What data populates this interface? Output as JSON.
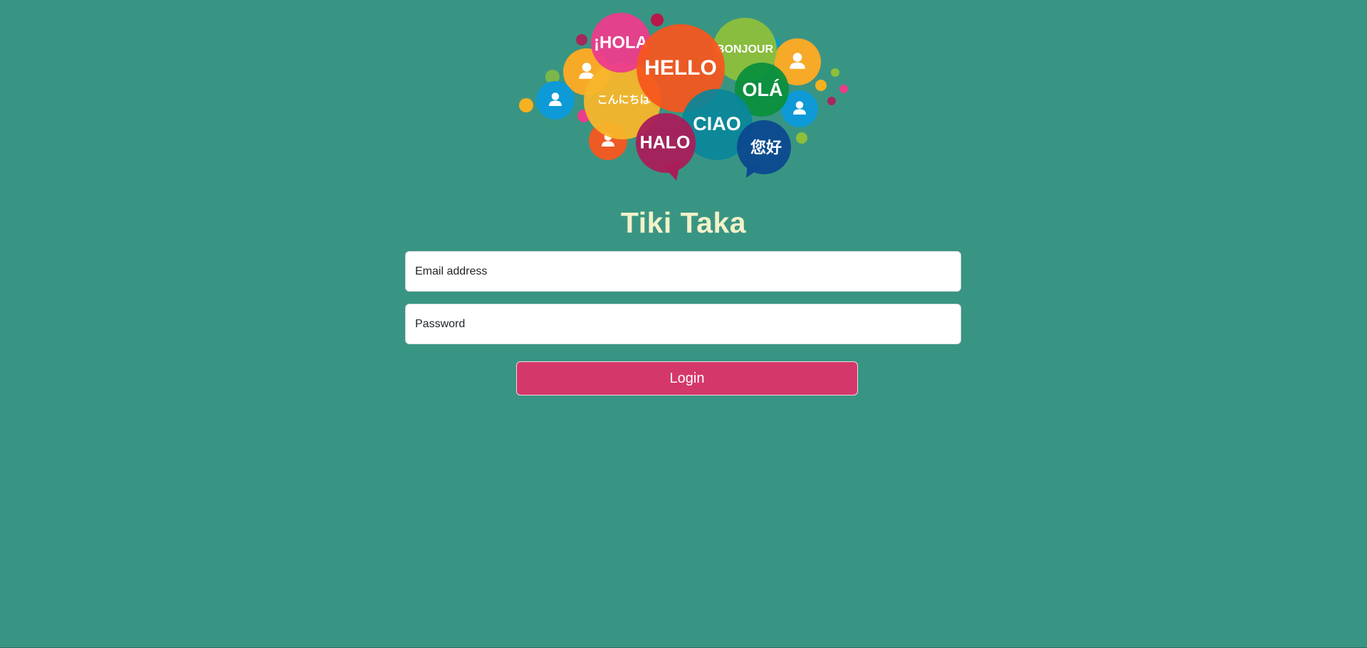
{
  "app": {
    "title": "Tiki Taka"
  },
  "logo": {
    "greetings": {
      "hola": "¡HOLA",
      "hello": "HELLO",
      "bonjour": "BONJOUR",
      "konnichiwa": "こんにちは",
      "ola": "OLÁ",
      "ciao": "CIAO",
      "halo": "HALO",
      "nihao": "您好"
    },
    "icon": "user-icon"
  },
  "form": {
    "email_placeholder": "Email address",
    "password_placeholder": "Password",
    "login_label": "Login"
  },
  "colors": {
    "background": "#399583",
    "title": "#f3f1c9",
    "button": "#d4386b"
  }
}
